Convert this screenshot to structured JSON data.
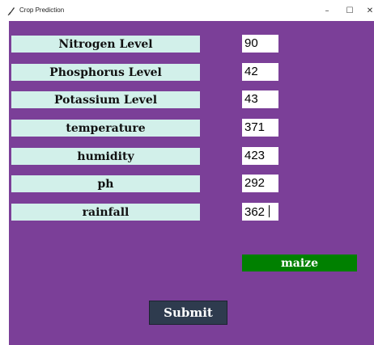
{
  "window": {
    "title": "Crop Prediction",
    "controls": {
      "minimize": "–",
      "maximize": "☐",
      "close": "✕"
    }
  },
  "form": {
    "fields": [
      {
        "label": "Nitrogen Level",
        "value": "90"
      },
      {
        "label": "Phosphorus Level",
        "value": "42"
      },
      {
        "label": "Potassium Level",
        "value": "43"
      },
      {
        "label": "temperature",
        "value": "371"
      },
      {
        "label": "humidity",
        "value": "423"
      },
      {
        "label": "ph",
        "value": "292"
      },
      {
        "label": "rainfall",
        "value": "362"
      }
    ],
    "result": "maize",
    "submit_label": "Submit"
  },
  "colors": {
    "background": "#7b3f98",
    "label_background": "#d2f0ea",
    "result_background": "#008000",
    "submit_background": "#2e3b4e"
  },
  "icons": {
    "app_icon": "feather-icon"
  }
}
